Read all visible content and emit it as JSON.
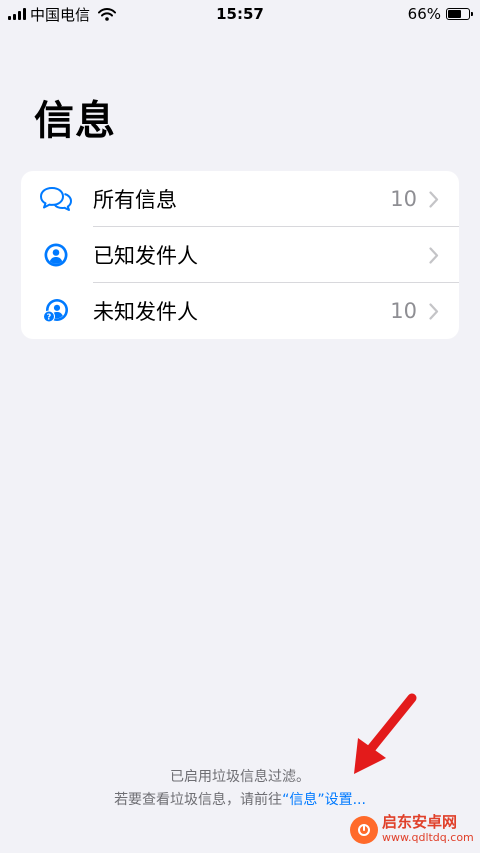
{
  "status_bar": {
    "carrier": "中国电信",
    "time": "15:57",
    "battery_percent": "66%",
    "battery_level": 0.66
  },
  "page": {
    "title": "信息"
  },
  "filters": [
    {
      "label": "所有信息",
      "count": "10",
      "icon": "chat-bubbles-icon"
    },
    {
      "label": "已知发件人",
      "count": "",
      "icon": "person-circle-icon"
    },
    {
      "label": "未知发件人",
      "count": "10",
      "icon": "unknown-person-icon"
    }
  ],
  "footer": {
    "line1": "已启用垃圾信息过滤。",
    "line2_prefix": "若要查看垃圾信息，请前往",
    "line2_link": "“信息”设置...",
    "line2_suffix": ""
  },
  "watermark": {
    "title": "启东安卓网",
    "url": "www.qdltdq.com"
  },
  "colors": {
    "accent": "#007aff",
    "background": "#f2f2f7",
    "arrow": "#e31b1b"
  }
}
